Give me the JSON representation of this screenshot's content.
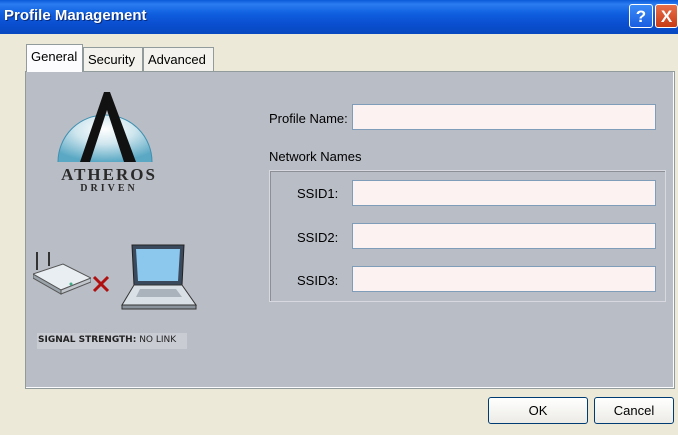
{
  "window": {
    "title": "Profile Management",
    "help_label": "?",
    "close_label": "X"
  },
  "tabs": [
    {
      "label": "General",
      "active": true
    },
    {
      "label": "Security",
      "active": false
    },
    {
      "label": "Advanced",
      "active": false
    }
  ],
  "brand": {
    "line1": "ATHEROS",
    "line2": "DRIVEN"
  },
  "signal": {
    "label": "SIGNAL STRENGTH:",
    "value": "NO LINK"
  },
  "form": {
    "profile_name_label": "Profile Name:",
    "profile_name_value": "",
    "network_names_label": "Network Names",
    "ssid1_label": "SSID1:",
    "ssid1_value": "",
    "ssid2_label": "SSID2:",
    "ssid2_value": "",
    "ssid3_label": "SSID3:",
    "ssid3_value": ""
  },
  "buttons": {
    "ok_label": "OK",
    "cancel_label": "Cancel"
  },
  "icons": {
    "router": "router-icon",
    "laptop": "laptop-icon",
    "no_link": "x-mark-icon",
    "logo": "atheros-logo-icon"
  }
}
